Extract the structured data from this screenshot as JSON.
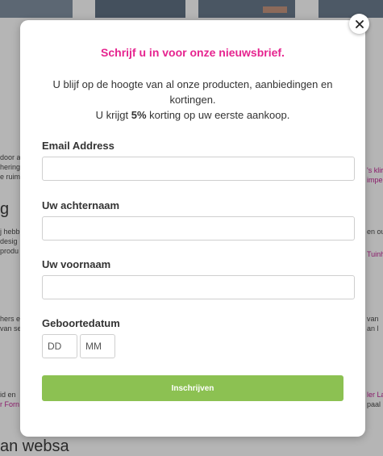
{
  "background": {
    "left_lines": [
      "door a",
      "hering",
      "e ruim",
      "j hebb",
      "desig",
      "produ",
      "hers e",
      "van se",
      "id en"
    ],
    "left_link": "r Forn",
    "right_lines": [
      "en ou",
      "van",
      "an l",
      "paal"
    ],
    "right_links": [
      "'s klir",
      "impe",
      "Tuinh",
      "ler La"
    ],
    "heading_left": "g",
    "footer_heading": "an websa"
  },
  "modal": {
    "title": "Schrijf u in voor onze nieuwsbrief.",
    "intro_line1": "U blijf op de hoogte van al onze producten, aanbiedingen en kortingen.",
    "intro_pre": "U krijgt ",
    "intro_bold": "5%",
    "intro_post": " korting op uw eerste aankoop.",
    "email_label": "Email Address",
    "email_value": "",
    "lastname_label": "Uw achternaam",
    "lastname_value": "",
    "firstname_label": "Uw voornaam",
    "firstname_value": "",
    "birthdate_label": "Geboortedatum",
    "day_placeholder": "DD",
    "month_placeholder": "MM",
    "submit_label": "Inschrijven"
  },
  "colors": {
    "title": "#e6248f",
    "submit": "#8cc152"
  },
  "icons": {
    "close": "close-icon"
  }
}
